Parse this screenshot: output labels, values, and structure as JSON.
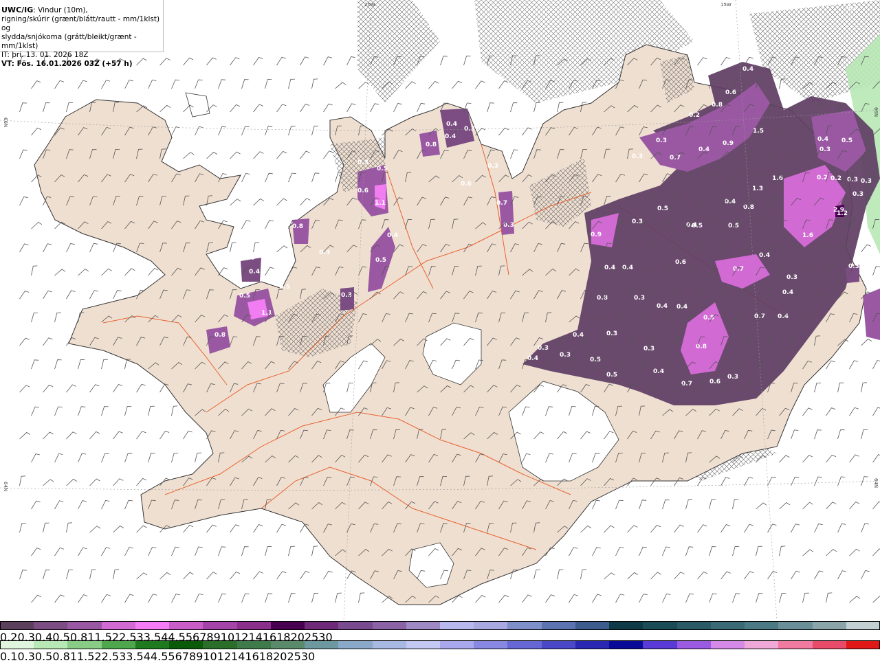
{
  "info": {
    "title_bold": "UWC/IG",
    "title_rest": ": Vindur (10m),",
    "line2": "rigning/skúrir (grænt/blátt/rautt - mm/1klst) og",
    "line3": "slydda/snjókoma (grátt/bleikt/grænt - mm/1klst)",
    "line4": "IT: þri. 13. 01. 2026 18Z",
    "line5": "VT: Fös. 16.01.2026 03Z (+57 h)"
  },
  "grid_labels": {
    "lon_20w": "20W",
    "lon_15w": "15W",
    "lat_66n_left": "66N",
    "lat_66n_right": "66N",
    "lat_64n_left": "64N",
    "lat_64n_right": "64N"
  },
  "colors": {
    "land": "#efdfd1",
    "sea": "#ffffff",
    "roads": "#e8622e",
    "coast": "#333333",
    "glacier": "#ffffff",
    "precip_dark": "#5e3d63",
    "precip_mid": "#8d4f9a",
    "precip_light": "#d55ed6",
    "precip_bright": "#f27cf2",
    "rain_green": "#b7e8b5"
  },
  "snow_scale": {
    "labels": [
      "0.2",
      "0.3",
      "0.4",
      "0.5",
      "0.8",
      "1",
      "1.5",
      "2",
      "2.5",
      "3",
      "3.5",
      "4",
      "4.5",
      "5",
      "6",
      "7",
      "8",
      "9",
      "10",
      "12",
      "14",
      "16",
      "18",
      "20",
      "25",
      "30"
    ],
    "colors": [
      "#5a405c",
      "#7b4d82",
      "#9a58a3",
      "#d26ad4",
      "#f57cf5",
      "#c95ec9",
      "#a443a8",
      "#8a2f8c",
      "#4a0050",
      "#6e2a78",
      "#7a4a90",
      "#8a62a5",
      "#9f89c4",
      "#b8b8ee",
      "#a9a9e2",
      "#7f8fca",
      "#5c74b0",
      "#3e5c8e",
      "#0e3a48",
      "#1a4c58",
      "#2a5a66",
      "#3a6a74",
      "#4b7a84",
      "#6a8f98",
      "#8aa4aa",
      "#c2d0d4"
    ]
  },
  "rain_scale": {
    "labels": [
      "0.1",
      "0.3",
      "0.5",
      "0.8",
      "1",
      "1.5",
      "2",
      "2.5",
      "3",
      "3.5",
      "4",
      "4.5",
      "5",
      "6",
      "7",
      "8",
      "9",
      "10",
      "12",
      "14",
      "16",
      "18",
      "20",
      "25",
      "30"
    ],
    "colors": [
      "#dff5dd",
      "#b7e8b5",
      "#88cc86",
      "#4ea74c",
      "#1f7a1f",
      "#0a5a0a",
      "#2a6e2a",
      "#3f7a4a",
      "#5a8a6a",
      "#6d98a0",
      "#8aa8c8",
      "#a7b8e2",
      "#c2c8f2",
      "#aaa8ec",
      "#8888e2",
      "#6666d4",
      "#4a48c6",
      "#2a28b2",
      "#0a0a98",
      "#5a3ad6",
      "#9a5ae2",
      "#d68ae8",
      "#f0a8d8",
      "#f07aa0",
      "#e84a6a",
      "#e01818"
    ]
  },
  "precip_labels": [
    {
      "v": "0.4"
    },
    {
      "v": "0.6"
    },
    {
      "v": "0.8"
    },
    {
      "v": "0.2"
    },
    {
      "v": "0.3"
    },
    {
      "v": "1.5"
    },
    {
      "v": "0.9"
    },
    {
      "v": "0.4"
    },
    {
      "v": "0.7"
    },
    {
      "v": "0.3"
    },
    {
      "v": "0.4"
    },
    {
      "v": "0.5"
    },
    {
      "v": "0.3"
    },
    {
      "v": "1.6"
    },
    {
      "v": "0.2"
    },
    {
      "v": "0.2"
    },
    {
      "v": "0.3"
    },
    {
      "v": "1.3"
    },
    {
      "v": "0.3"
    },
    {
      "v": "0.3"
    },
    {
      "v": "0.4"
    },
    {
      "v": "0.8"
    },
    {
      "v": "0.5"
    },
    {
      "v": "2.9"
    },
    {
      "v": "1.2"
    },
    {
      "v": "0.5"
    },
    {
      "v": "0.3"
    },
    {
      "v": "0.4"
    },
    {
      "v": "0.5"
    },
    {
      "v": "1.6"
    },
    {
      "v": "0.9"
    },
    {
      "v": "0.6"
    },
    {
      "v": "0.4"
    },
    {
      "v": "0.7"
    },
    {
      "v": "0.4"
    },
    {
      "v": "0.4"
    },
    {
      "v": "0.3"
    },
    {
      "v": "0.4"
    },
    {
      "v": "0.8"
    },
    {
      "v": "0.3"
    },
    {
      "v": "0.4"
    },
    {
      "v": "0.4"
    },
    {
      "v": "0.5"
    },
    {
      "v": "0.7"
    },
    {
      "v": "0.4"
    },
    {
      "v": "0.4"
    },
    {
      "v": "0.3"
    },
    {
      "v": "0.3"
    },
    {
      "v": "0.8"
    },
    {
      "v": "0.3"
    },
    {
      "v": "0.4"
    },
    {
      "v": "0.3"
    },
    {
      "v": "0.5"
    },
    {
      "v": "0.5"
    },
    {
      "v": "0.4"
    },
    {
      "v": "0.7"
    },
    {
      "v": "0.6"
    },
    {
      "v": "0.3"
    },
    {
      "v": "0.8"
    },
    {
      "v": "0.4"
    },
    {
      "v": "0.4"
    },
    {
      "v": "0.5"
    },
    {
      "v": "1.1"
    },
    {
      "v": "0.8"
    },
    {
      "v": "0.3"
    },
    {
      "v": "0.5"
    },
    {
      "v": "0.4"
    },
    {
      "v": "0.3"
    },
    {
      "v": "1.1"
    },
    {
      "v": "0.6"
    },
    {
      "v": "0.7"
    },
    {
      "v": "0.3"
    },
    {
      "v": "0.8"
    },
    {
      "v": "0.4"
    },
    {
      "v": "0.3"
    },
    {
      "v": "0.4"
    },
    {
      "v": "0.6"
    },
    {
      "v": "0.3"
    },
    {
      "v": "0.5"
    },
    {
      "v": "0.3"
    },
    {
      "v": "0.5"
    },
    {
      "v": "0.3"
    },
    {
      "v": "0.3"
    }
  ]
}
